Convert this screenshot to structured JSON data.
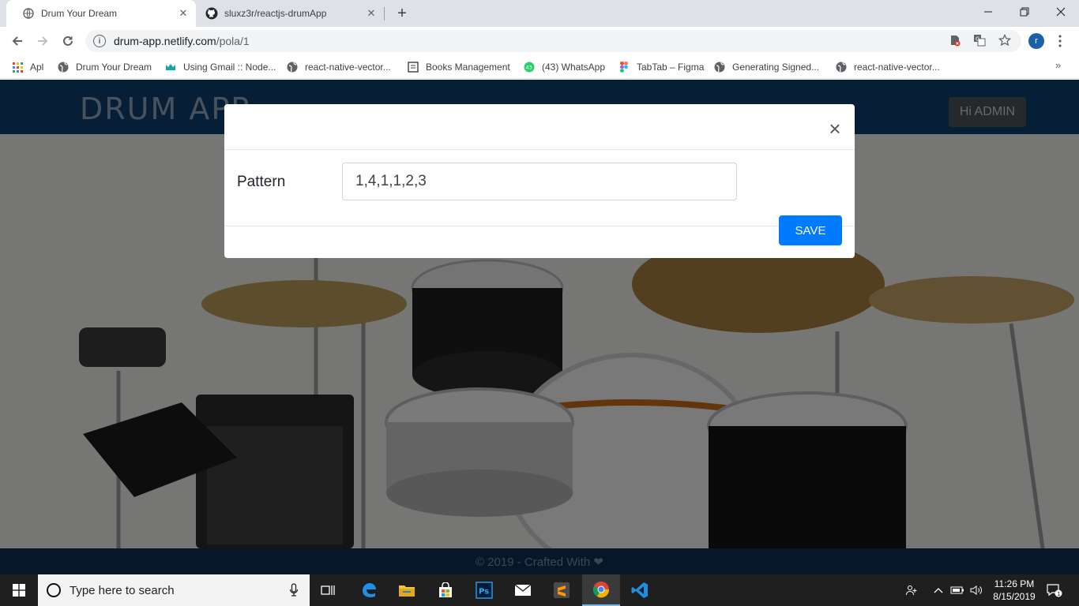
{
  "browser": {
    "tabs": [
      {
        "title": "Drum Your Dream",
        "active": true,
        "icon": "globe-icon"
      },
      {
        "title": "sluxz3r/reactjs-drumApp",
        "active": false,
        "icon": "github-icon"
      }
    ],
    "url_host": "drum-app.netlify.com",
    "url_path": "/pola/1",
    "profile_initial": "r",
    "bookmarks": [
      {
        "label": "Apl",
        "icon": "apps-grid-icon"
      },
      {
        "label": "Drum Your Dream",
        "icon": "globe-icon"
      },
      {
        "label": "Using Gmail :: Node...",
        "icon": "crown-icon"
      },
      {
        "label": "react-native-vector...",
        "icon": "globe-icon"
      },
      {
        "label": "Books Management",
        "icon": "page-icon"
      },
      {
        "label": "(43) WhatsApp",
        "icon": "whatsapp-icon"
      },
      {
        "label": "TabTab – Figma",
        "icon": "figma-icon"
      },
      {
        "label": "Generating Signed...",
        "icon": "globe-icon"
      },
      {
        "label": "react-native-vector...",
        "icon": "globe-icon"
      }
    ],
    "whatsapp_badge": "43"
  },
  "app": {
    "brand": "DRUM APP",
    "user_button": "Hi ADMIN",
    "footer": "© 2019 - Crafted With ❤",
    "accent": "#007bff",
    "header_color": "#0f3e6d"
  },
  "modal": {
    "label": "Pattern",
    "input_value": "1,4,1,1,2,3",
    "save_label": "SAVE",
    "close_glyph": "×"
  },
  "taskbar": {
    "search_placeholder": "Type here to search",
    "time": "11:26 PM",
    "date": "8/15/2019",
    "notifications": "1",
    "apps": [
      "task-view-icon",
      "edge-icon",
      "file-explorer-icon",
      "store-icon",
      "photoshop-icon",
      "mail-icon",
      "sublime-icon",
      "chrome-icon",
      "vscode-icon"
    ]
  }
}
